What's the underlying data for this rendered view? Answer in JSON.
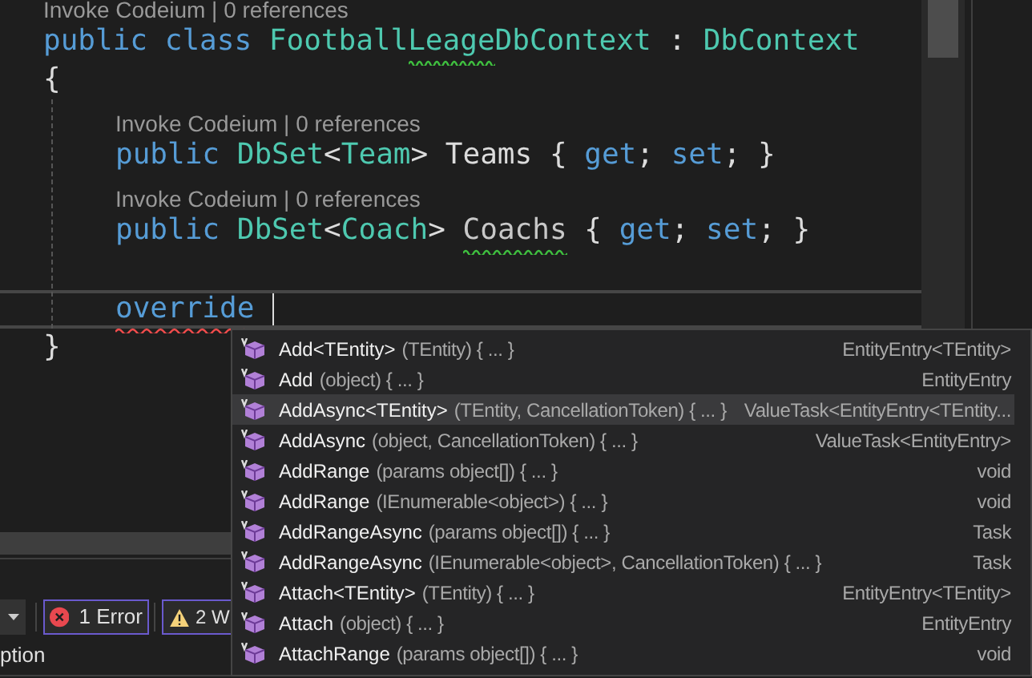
{
  "code_lines": [
    {
      "kind": "codelens",
      "text": "Invoke Codeium | 0 references"
    },
    {
      "kind": "code",
      "current": false,
      "tokens": [
        {
          "text": "public class ",
          "color": "#569cd6",
          "warning": false,
          "error": false
        },
        {
          "text": "Football",
          "color": "#4ec9b0",
          "warning": false,
          "error": false
        },
        {
          "text": "Leage",
          "color": "#4ec9b0",
          "warning": true,
          "error": false
        },
        {
          "text": "DbContext",
          "color": "#4ec9b0",
          "warning": false,
          "error": false
        },
        {
          "text": " : ",
          "color": "#dcdcdc",
          "warning": false,
          "error": false
        },
        {
          "text": "DbContext",
          "color": "#4ec9b0",
          "warning": false,
          "error": false
        }
      ]
    },
    {
      "kind": "code",
      "current": false,
      "tokens": [
        {
          "text": "{",
          "color": "#dcdcdc",
          "warning": false,
          "error": false
        }
      ],
      "children": [
        {
          "kind": "codelens",
          "text": "Invoke Codeium | 0 references"
        },
        {
          "kind": "code",
          "current": false,
          "tokens": [
            {
              "text": "public ",
              "color": "#569cd6",
              "warning": false,
              "error": false
            },
            {
              "text": "DbSet",
              "color": "#4ec9b0",
              "warning": false,
              "error": false
            },
            {
              "text": "<",
              "color": "#dcdcdc",
              "warning": false,
              "error": false
            },
            {
              "text": "Team",
              "color": "#4ec9b0",
              "warning": false,
              "error": false
            },
            {
              "text": "> Teams { ",
              "color": "#dcdcdc",
              "warning": false,
              "error": false
            },
            {
              "text": "get",
              "color": "#569cd6",
              "warning": false,
              "error": false
            },
            {
              "text": "; ",
              "color": "#dcdcdc",
              "warning": false,
              "error": false
            },
            {
              "text": "set",
              "color": "#569cd6",
              "warning": false,
              "error": false
            },
            {
              "text": "; }",
              "color": "#dcdcdc",
              "warning": false,
              "error": false
            }
          ]
        },
        {
          "kind": "codelens",
          "text": "Invoke Codeium | 0 references"
        },
        {
          "kind": "code",
          "current": false,
          "tokens": [
            {
              "text": "public ",
              "color": "#569cd6",
              "warning": false,
              "error": false
            },
            {
              "text": "DbSet",
              "color": "#4ec9b0",
              "warning": false,
              "error": false
            },
            {
              "text": "<",
              "color": "#dcdcdc",
              "warning": false,
              "error": false
            },
            {
              "text": "Coach",
              "color": "#4ec9b0",
              "warning": false,
              "error": false
            },
            {
              "text": "> ",
              "color": "#dcdcdc",
              "warning": false,
              "error": false
            },
            {
              "text": "Coachs",
              "color": "#c8c8c8",
              "warning": true,
              "error": false
            },
            {
              "text": " { ",
              "color": "#dcdcdc",
              "warning": false,
              "error": false
            },
            {
              "text": "get",
              "color": "#569cd6",
              "warning": false,
              "error": false
            },
            {
              "text": "; ",
              "color": "#dcdcdc",
              "warning": false,
              "error": false
            },
            {
              "text": "set",
              "color": "#569cd6",
              "warning": false,
              "error": false
            },
            {
              "text": "; }",
              "color": "#dcdcdc",
              "warning": false,
              "error": false
            }
          ]
        },
        {
          "kind": "blank",
          "current": false
        },
        {
          "kind": "code",
          "current": true,
          "tokens": [
            {
              "text": "override",
              "color": "#569cd6",
              "warning": false,
              "error": true
            }
          ]
        }
      ]
    },
    {
      "kind": "code",
      "current": false,
      "tokens": [
        {
          "text": "}",
          "color": "#dcdcdc",
          "warning": false,
          "error": false
        }
      ]
    }
  ],
  "completion": [
    {
      "name": "Add<TEntity>",
      "params": "(TEntity) { ... }",
      "type": "EntityEntry<TEntity>",
      "selected": false
    },
    {
      "name": "Add",
      "params": "(object) { ... }",
      "type": "EntityEntry",
      "selected": false
    },
    {
      "name": "AddAsync<TEntity>",
      "params": "(TEntity, CancellationToken) { ... }",
      "type": "ValueTask<EntityEntry<TEntity...",
      "selected": true
    },
    {
      "name": "AddAsync",
      "params": "(object, CancellationToken) { ... }",
      "type": "ValueTask<EntityEntry>",
      "selected": false
    },
    {
      "name": "AddRange",
      "params": "(params object[]) { ... }",
      "type": "void",
      "selected": false
    },
    {
      "name": "AddRange",
      "params": "(IEnumerable<object>) { ... }",
      "type": "void",
      "selected": false
    },
    {
      "name": "AddRangeAsync",
      "params": "(params object[]) { ... }",
      "type": "Task",
      "selected": false
    },
    {
      "name": "AddRangeAsync",
      "params": "(IEnumerable<object>, CancellationToken) { ... }",
      "type": "Task",
      "selected": false
    },
    {
      "name": "Attach<TEntity>",
      "params": "(TEntity) { ... }",
      "type": "EntityEntry<TEntity>",
      "selected": false
    },
    {
      "name": "Attach",
      "params": "(object) { ... }",
      "type": "EntityEntry",
      "selected": false
    },
    {
      "name": "AttachRange",
      "params": "(params object[]) { ... }",
      "type": "void",
      "selected": false
    }
  ],
  "error_list": {
    "errors": "1 Error",
    "warnings": "2 W",
    "column_header": "ption"
  }
}
